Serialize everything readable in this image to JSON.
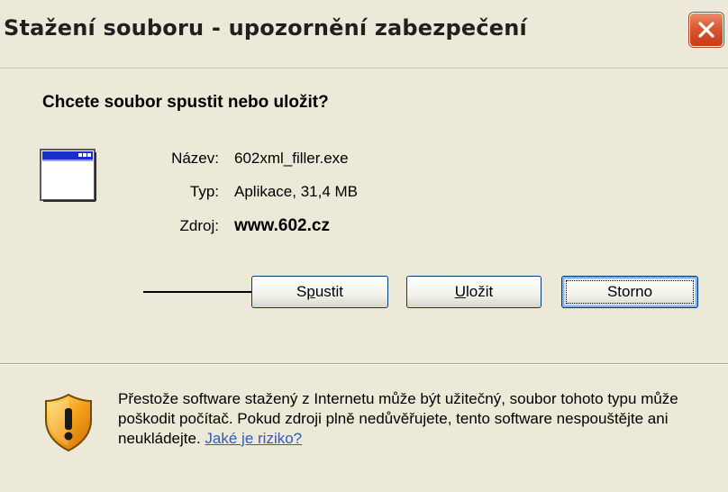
{
  "window": {
    "title": "Stažení souboru - upozornění zabezpečení"
  },
  "dialog": {
    "question": "Chcete soubor spustit nebo uložit?",
    "info": {
      "name_label": "Název:",
      "name_value": "602xml_filler.exe",
      "type_label": "Typ:",
      "type_value": "Aplikace, 31,4 MB",
      "source_label": "Zdroj:",
      "source_value": "www.602.cz"
    },
    "buttons": {
      "run_prefix": "S",
      "run_access": "p",
      "run_rest": "ustit",
      "save_access": "U",
      "save_rest": "ložit",
      "cancel_label": "Storno"
    },
    "warning": {
      "text": "Přestože software stažený z Internetu může být užitečný, soubor tohoto typu může poškodit počítač. Pokud zdroji plně nedůvěřujete, tento software nespouštějte ani neukládejte.",
      "link": "Jaké je riziko?"
    }
  },
  "icons": {
    "close": "close-icon",
    "app": "application-window-icon",
    "shield": "security-shield-icon",
    "arrow": "pointer-arrow"
  },
  "colors": {
    "dialog_bg": "#ece9d8",
    "close_button": "#d9572f",
    "link": "#2a5bd7",
    "button_border": "#003c74"
  }
}
